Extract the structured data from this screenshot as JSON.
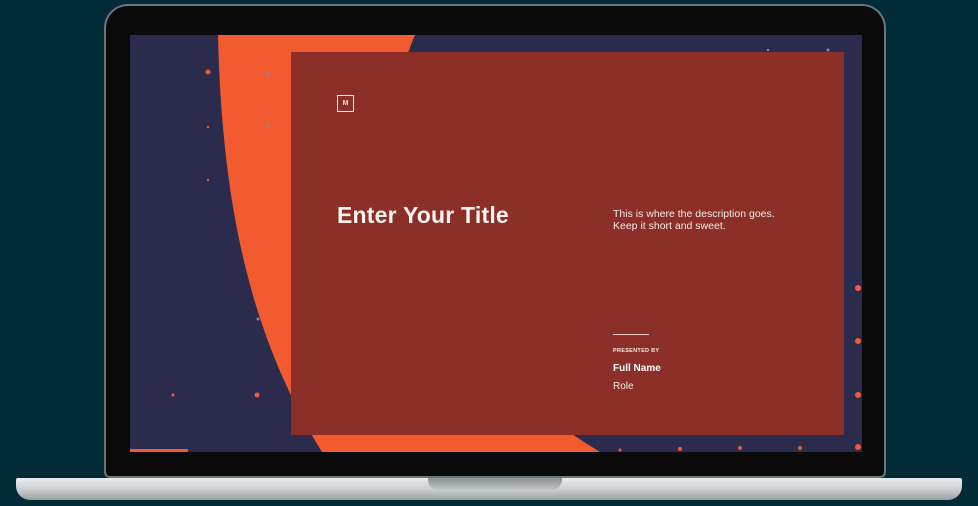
{
  "slide": {
    "logo_letter": "M",
    "title": "Enter Your Title",
    "description_line1": "This is where the description goes.",
    "description_line2": "Keep it short and sweet.",
    "presented_by_label": "PRESENTED BY",
    "presenter_name": "Full Name",
    "presenter_role": "Role"
  },
  "colors": {
    "background": "#022b38",
    "screen_navy": "#2b2c4d",
    "accent_orange": "#f25a30",
    "card_red": "#8b2f28",
    "text_light": "#fbf3ef"
  }
}
